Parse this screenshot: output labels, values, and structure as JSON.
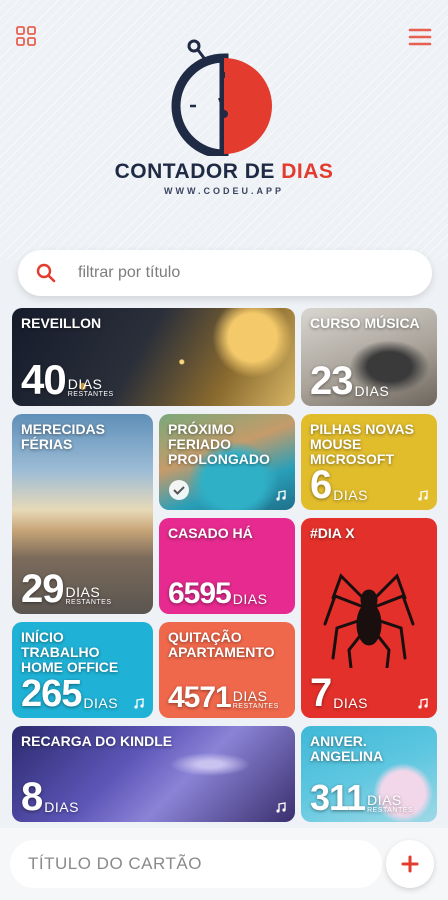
{
  "app": {
    "brand_part1": "CONTADOR DE ",
    "brand_part2": "DIAS",
    "site": "WWW.CODEU.APP"
  },
  "icons": {
    "grid": "grid-icon",
    "menu": "menu-icon",
    "search": "search-icon",
    "add": "plus-icon",
    "check": "check-icon",
    "note": "music-note-icon"
  },
  "colors": {
    "accent": "#e33b2e",
    "navy": "#1f2a44"
  },
  "search": {
    "placeholder": "filtrar por título"
  },
  "cards": [
    {
      "title": "REVEILLON",
      "number": "40",
      "unit": "DIAS",
      "sub": "RESTANTES"
    },
    {
      "title": "CURSO MÚSICA",
      "number": "23",
      "unit": "DIAS",
      "sub": ""
    },
    {
      "title": "MERECIDAS FÉRIAS",
      "number": "29",
      "unit": "DIAS",
      "sub": "RESTANTES"
    },
    {
      "title": "PRÓXIMO FERIADO PROLONGADO",
      "number": "",
      "unit": "",
      "sub": ""
    },
    {
      "title": "PILHAS NOVAS MOUSE MICROSOFT",
      "number": "6",
      "unit": "DIAS",
      "sub": ""
    },
    {
      "title": "CASADO HÁ",
      "number": "6595",
      "unit": "DIAS",
      "sub": ""
    },
    {
      "title": "#DIA X",
      "number": "7",
      "unit": "DIAS",
      "sub": ""
    },
    {
      "title": "INÍCIO TRABALHO HOME OFFICE",
      "number": "265",
      "unit": "DIAS",
      "sub": ""
    },
    {
      "title": "QUITAÇÃO APARTAMENTO",
      "number": "4571",
      "unit": "DIAS",
      "sub": "RESTANTES"
    },
    {
      "title": "RECARGA DO KINDLE",
      "number": "8",
      "unit": "DIAS",
      "sub": ""
    },
    {
      "title": "ANIVER. ANGELINA",
      "number": "311",
      "unit": "DIAS",
      "sub": "RESTANTES"
    }
  ],
  "bottom": {
    "placeholder": "TÍTULO DO CARTÃO"
  }
}
